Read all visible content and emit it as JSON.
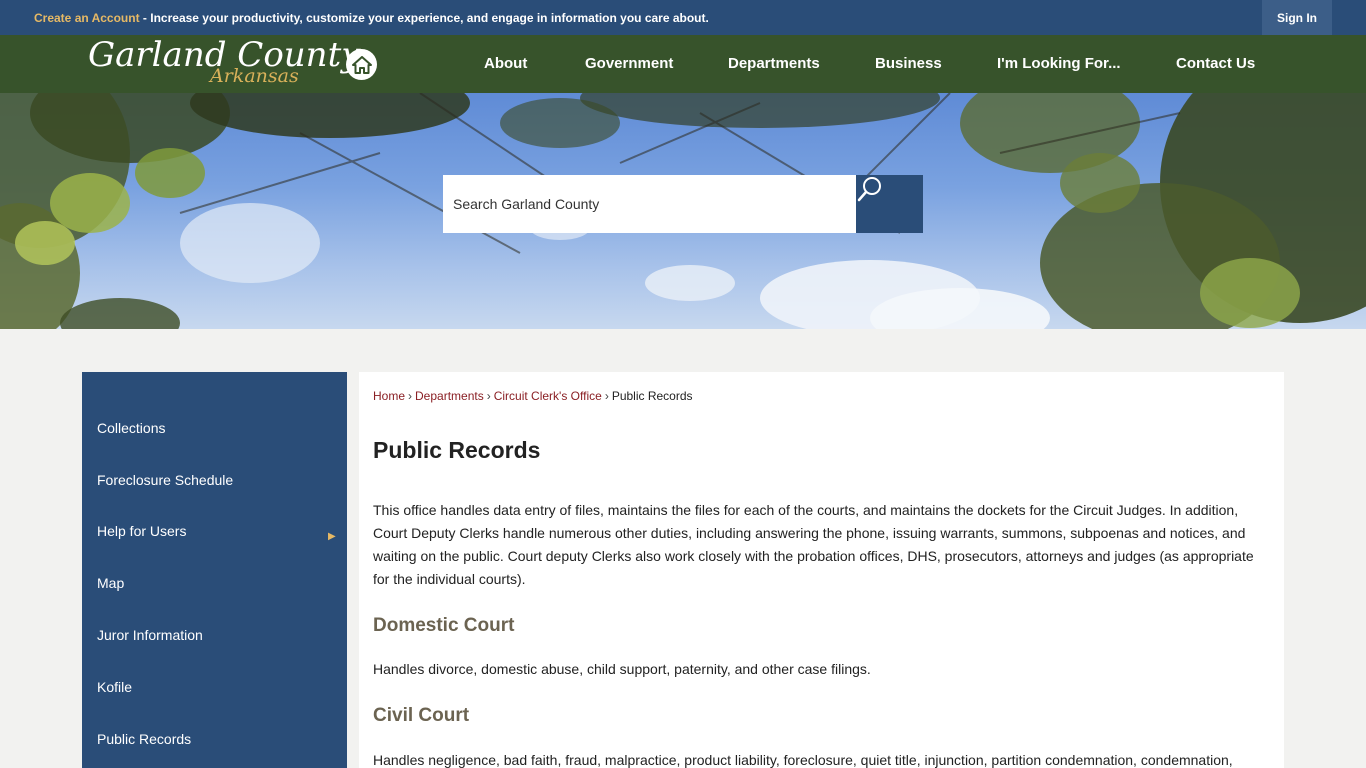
{
  "topbar": {
    "create_account_link": "Create an Account",
    "promo_text": " - Increase your productivity, customize your experience, and engage in information you care about.",
    "sign_in_label": "Sign In"
  },
  "header": {
    "logo_line1": "Garland County",
    "logo_line2": "Arkansas",
    "home_icon": "home-icon",
    "nav": [
      "About",
      "Government",
      "Departments",
      "Business",
      "I'm Looking For...",
      "Contact Us"
    ]
  },
  "search": {
    "placeholder": "Search Garland County",
    "button_icon": "search-icon"
  },
  "sidebar": {
    "items": [
      "Collections",
      "Foreclosure Schedule",
      "Help for Users",
      "Map",
      "Juror Information",
      "Kofile",
      "Public Records"
    ],
    "submenu_arrow": "▶"
  },
  "breadcrumb": {
    "home": "Home",
    "departments": "Departments",
    "office": "Circuit Clerk's Office",
    "current": "Public Records",
    "separator": "›"
  },
  "content": {
    "title": "Public Records",
    "intro": "This office handles data entry of files, maintains the files for each of the courts, and maintains the dockets for the Circuit Judges. In addition, Court Deputy Clerks handle numerous other duties, including answering the phone, issuing warrants, summons, subpoenas and notices, and waiting on the public. Court deputy Clerks also work closely with the probation offices, DHS, prosecutors, attorneys and judges (as appropriate for the individual courts).",
    "sections": [
      {
        "heading": "Domestic Court",
        "text": "Handles divorce, domestic abuse, child support, paternity, and other case filings."
      },
      {
        "heading": "Civil Court",
        "text": "Handles negligence, bad faith, fraud, malpractice, product liability, foreclosure, quiet title, injunction, partition condemnation, condemnation,"
      }
    ]
  },
  "colors": {
    "topbar": "#2a4d78",
    "navbar": "#37532b",
    "accent_gold": "#e6b965",
    "link": "#8a1f24",
    "section_heading": "#6b6351"
  }
}
